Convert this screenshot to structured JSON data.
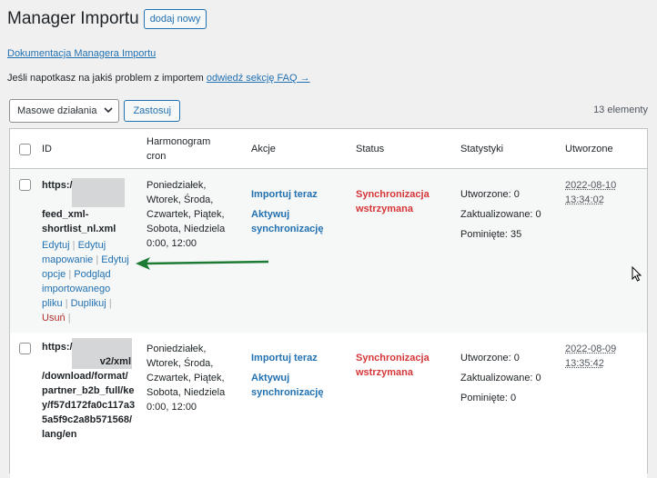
{
  "header": {
    "title": "Manager Importu",
    "add_new": "dodaj nowy"
  },
  "doc_link": "Dokumentacja Managera Importu",
  "faq": {
    "text": "Jeśli napotkasz na jakiś problem z importem ",
    "link": "odwiedź sekcję FAQ →"
  },
  "bulk": {
    "select_value": "Masowe działania",
    "apply": "Zastosuj"
  },
  "count": "13 elementy",
  "columns": {
    "id": "ID",
    "schedule1": "Harmonogram",
    "schedule2": "cron",
    "actions": "Akcje",
    "status": "Status",
    "stats": "Statystyki",
    "created": "Utworzone"
  },
  "rows": [
    {
      "id_lines": [
        "https:/",
        "feed_xml-",
        "shortlist_nl.xml"
      ],
      "row_actions": {
        "edit": "Edytuj",
        "edit_mapping_1": "Edytuj",
        "edit_mapping_2": "mapowanie",
        "edit_options_1": "Edytuj",
        "edit_options_2": "opcje",
        "preview_1": "Podgląd",
        "preview_2": "importowanego",
        "preview_3": "pliku",
        "duplicate": "Duplikuj",
        "delete": "Usuń"
      },
      "schedule": [
        "Poniedziałek,",
        "Wtorek, Środa,",
        "Czwartek, Piątek,",
        "Sobota, Niedziela",
        "0:00, 12:00"
      ],
      "actions": {
        "import_now": "Importuj teraz",
        "activate_1": "Aktywuj",
        "activate_2": "synchronizację"
      },
      "status": [
        "Synchronizacja",
        "wstrzymana"
      ],
      "stats": {
        "created": "Utworzone: 0",
        "updated": "Zaktualizowane: 0",
        "skipped": "Pominięte: 35"
      },
      "date": [
        "2022-08-10",
        "13:34:02"
      ]
    },
    {
      "id_lines": [
        "https:/",
        "v2/xml",
        "/download/format/",
        "partner_b2b_full/ke",
        "y/f57d172fa0c117a3",
        "5a5f9c2a8b571568/",
        "lang/en"
      ],
      "schedule": [
        "Poniedziałek,",
        "Wtorek, Środa,",
        "Czwartek, Piątek,",
        "Sobota, Niedziela",
        "0:00, 12:00"
      ],
      "actions": {
        "import_now": "Importuj teraz",
        "activate_1": "Aktywuj",
        "activate_2": "synchronizację"
      },
      "status": [
        "Synchronizacja",
        "wstrzymana"
      ],
      "stats": {
        "created": "Utworzone: 0",
        "updated": "Zaktualizowane: 0",
        "skipped": "Pominięte: 0"
      },
      "date": [
        "2022-08-09",
        "13:35:42"
      ]
    }
  ],
  "colors": {
    "link": "#2271b1",
    "danger": "#d63638",
    "arrow": "#1e7b34"
  }
}
